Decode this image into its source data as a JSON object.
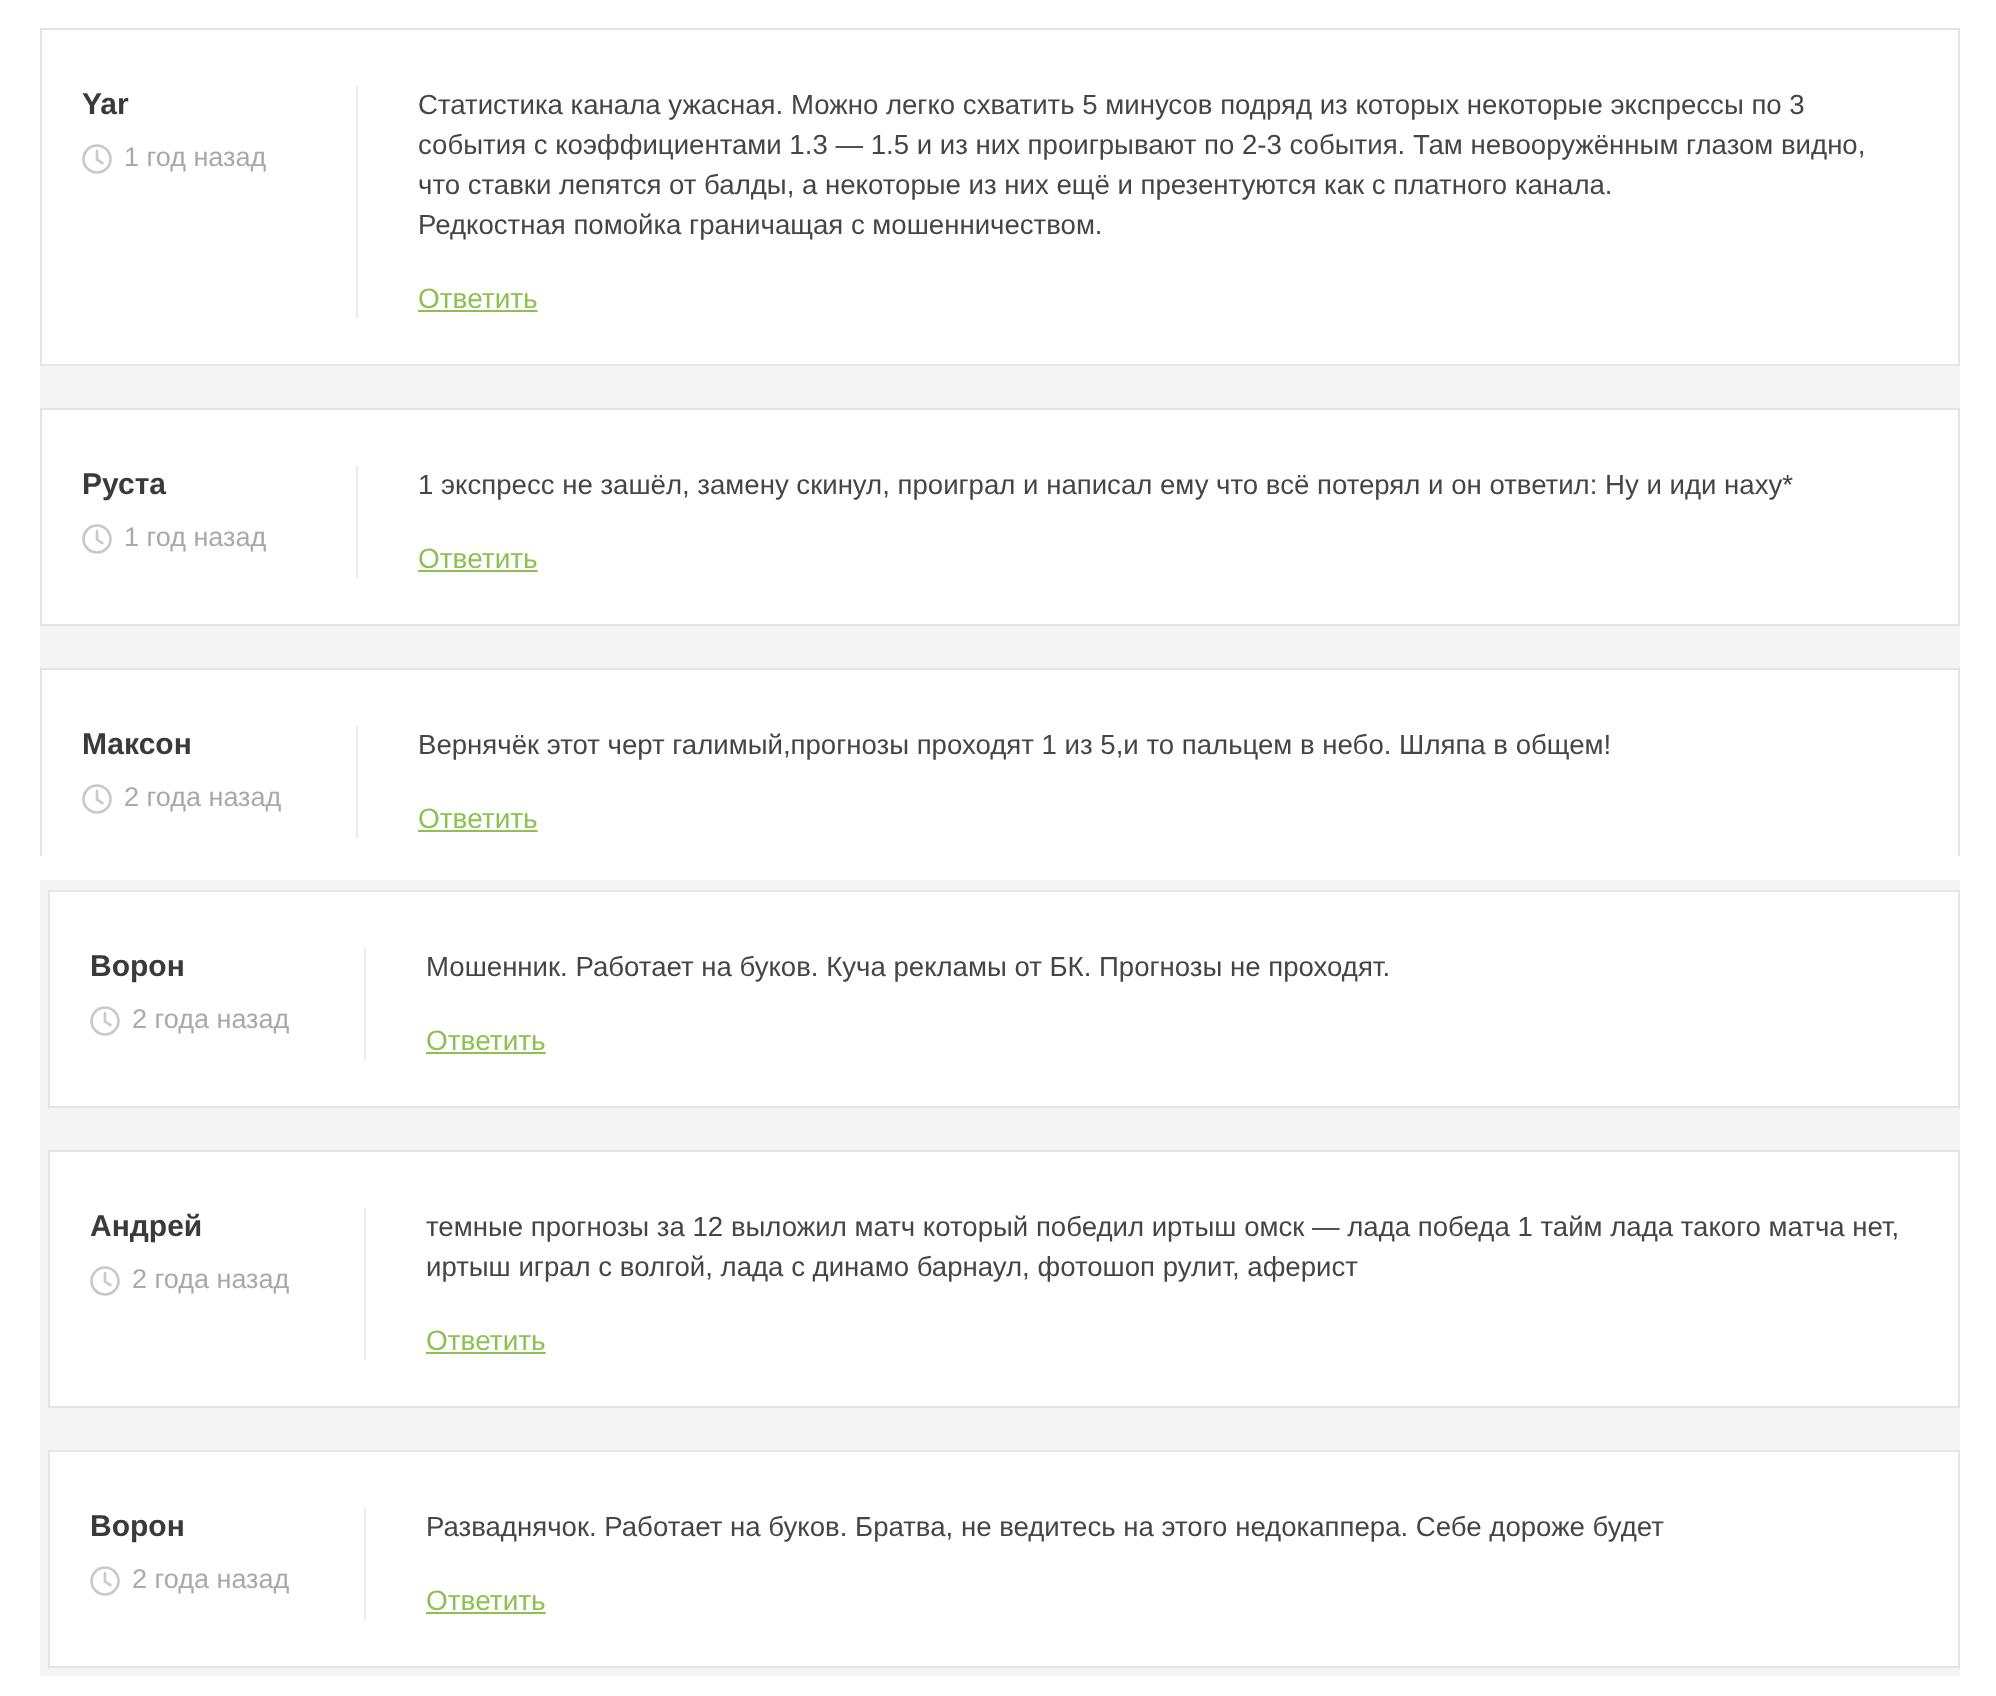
{
  "fragments": [
    {
      "comments": [
        {
          "author": "Yar",
          "time": "1 год назад",
          "text": "Статистика канала ужасная. Можно легко схватить 5 минусов подряд из которых некоторые экспрессы по 3 события с коэффициентами 1.3 — 1.5 и из них проигрывают по 2-3 события. Там невооружённым глазом видно, что ставки лепятся от балды, а некоторые из них ещё и презентуются как с платного канала.\nРедкостная помойка граничащая с мошенничеством.",
          "reply": "Ответить"
        },
        {
          "author": "Руста",
          "time": "1 год назад",
          "text": "1 экспресс не зашёл, замену скинул, проиграл и написал ему что всё потерял и он ответил: Ну и иди наху*",
          "reply": "Ответить"
        },
        {
          "author": "Максон",
          "time": "2 года назад",
          "text": "Вернячёк этот черт галимый,прогнозы проходят 1 из 5,и то пальцем в небо. Шляпа в общем!",
          "reply": "Ответить"
        }
      ]
    },
    {
      "comments": [
        {
          "author": "Ворон",
          "time": "2 года назад",
          "text": "Мошенник. Работает на буков. Куча рекламы от БК. Прогнозы не проходят.",
          "reply": "Ответить"
        },
        {
          "author": "Андрей",
          "time": "2 года назад",
          "text": "темные прогнозы за 12 выложил матч который победил иртыш омск — лада победа 1 тайм лада такого матча нет, иртыш играл с волгой, лада с динамо барнаул, фотошоп рулит, аферист",
          "reply": "Ответить"
        },
        {
          "author": "Ворон",
          "time": "2 года назад",
          "text": "Разваднячок. Работает на буков. Братва, не ведитесь на этого недокаппера. Себе дороже будет",
          "reply": "Ответить"
        }
      ]
    }
  ]
}
